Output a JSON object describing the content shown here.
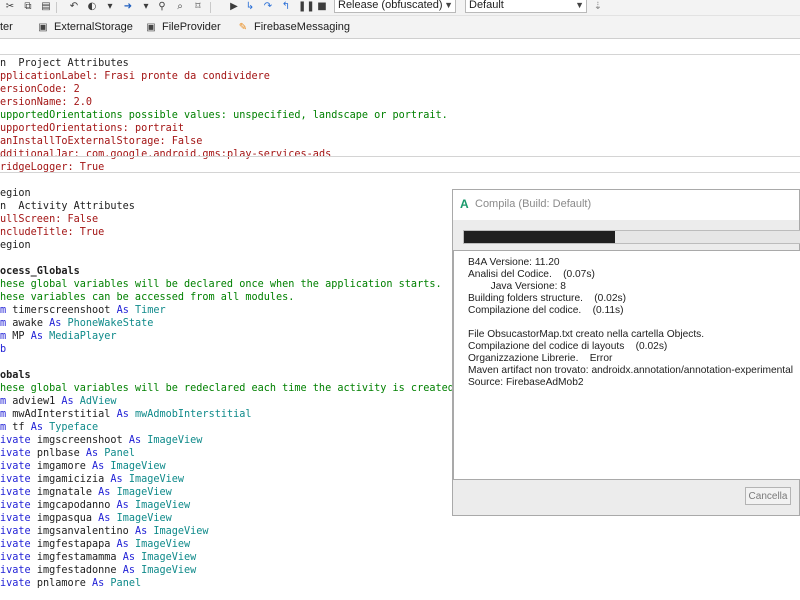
{
  "toolbar": {
    "build_config": "Release (obfuscated)",
    "platform": "Default",
    "icons": [
      "scissors-icon",
      "copy-icon",
      "paste-icon",
      "back-icon",
      "forward-icon",
      "run-icon",
      "step-into-icon",
      "step-over-icon",
      "step-out-icon",
      "pause-icon",
      "stop-icon"
    ]
  },
  "tabs": [
    {
      "label": "ter",
      "icon": ""
    },
    {
      "label": "ExternalStorage",
      "icon": "module-icon"
    },
    {
      "label": "FileProvider",
      "icon": "module-icon"
    },
    {
      "label": "FirebaseMessaging",
      "icon": "firebase-icon"
    }
  ],
  "code": {
    "lines": [
      [
        {
          "t": "n  Project Attributes",
          "c": "plain"
        }
      ],
      [
        {
          "t": "pplicationLabel: ",
          "c": "attr"
        },
        {
          "t": "Frasi pronte da condividere",
          "c": "st"
        }
      ],
      [
        {
          "t": "ersionCode: ",
          "c": "attr"
        },
        {
          "t": "2",
          "c": "st"
        }
      ],
      [
        {
          "t": "ersionName: ",
          "c": "attr"
        },
        {
          "t": "2.0",
          "c": "st"
        }
      ],
      [
        {
          "t": "upportedOrientations possible values: unspecified, landscape or portrait.",
          "c": "cm"
        }
      ],
      [
        {
          "t": "upportedOrientations: ",
          "c": "attr"
        },
        {
          "t": "portrait",
          "c": "st"
        }
      ],
      [
        {
          "t": "anInstallToExternalStorage: ",
          "c": "attr"
        },
        {
          "t": "False",
          "c": "st"
        }
      ],
      [
        {
          "t": "dditionalJar: ",
          "c": "attr"
        },
        {
          "t": "com.google.android.gms:play-services-ads",
          "c": "st"
        }
      ],
      [
        {
          "t": "ridgeLogger: ",
          "c": "attr"
        },
        {
          "t": "True",
          "c": "st"
        }
      ],
      [
        {
          "t": "",
          "c": "plain"
        }
      ],
      [
        {
          "t": "egion",
          "c": "plain"
        }
      ],
      [
        {
          "t": "n  Activity Attributes",
          "c": "plain"
        }
      ],
      [
        {
          "t": "ullScreen: ",
          "c": "attr"
        },
        {
          "t": "False",
          "c": "st"
        }
      ],
      [
        {
          "t": "ncludeTitle: ",
          "c": "attr"
        },
        {
          "t": "True",
          "c": "st"
        }
      ],
      [
        {
          "t": "egion",
          "c": "plain"
        }
      ],
      [
        {
          "t": "",
          "c": "plain"
        }
      ],
      [
        {
          "t": "ocess_Globals",
          "c": "plain",
          "b": true
        }
      ],
      [
        {
          "t": "hese global variables will be declared once when the application starts.",
          "c": "cm"
        }
      ],
      [
        {
          "t": "hese variables can be accessed from all modules.",
          "c": "cm"
        }
      ],
      [
        {
          "t": "m ",
          "c": "kw"
        },
        {
          "t": "timerscreenshoot ",
          "c": "plain"
        },
        {
          "t": "As ",
          "c": "kw"
        },
        {
          "t": "Timer",
          "c": "ty"
        }
      ],
      [
        {
          "t": "m ",
          "c": "kw"
        },
        {
          "t": "awake ",
          "c": "plain"
        },
        {
          "t": "As ",
          "c": "kw"
        },
        {
          "t": "PhoneWakeState",
          "c": "ty"
        }
      ],
      [
        {
          "t": "m ",
          "c": "kw"
        },
        {
          "t": "MP ",
          "c": "plain"
        },
        {
          "t": "As ",
          "c": "kw"
        },
        {
          "t": "MediaPlayer",
          "c": "ty"
        }
      ],
      [
        {
          "t": "b",
          "c": "kw"
        }
      ],
      [
        {
          "t": "",
          "c": "plain"
        }
      ],
      [
        {
          "t": "obals",
          "c": "plain",
          "b": true
        }
      ],
      [
        {
          "t": "hese global variables will be redeclared each time the activity is created.",
          "c": "cm"
        }
      ],
      [
        {
          "t": "m ",
          "c": "kw"
        },
        {
          "t": "adview1 ",
          "c": "plain"
        },
        {
          "t": "As ",
          "c": "kw"
        },
        {
          "t": "AdView",
          "c": "ty"
        }
      ],
      [
        {
          "t": "m ",
          "c": "kw"
        },
        {
          "t": "mwAdInterstitial ",
          "c": "plain"
        },
        {
          "t": "As ",
          "c": "kw"
        },
        {
          "t": "mwAdmobInterstitial",
          "c": "ty"
        }
      ],
      [
        {
          "t": "m ",
          "c": "kw"
        },
        {
          "t": "tf ",
          "c": "plain"
        },
        {
          "t": "As ",
          "c": "kw"
        },
        {
          "t": "Typeface",
          "c": "ty"
        }
      ],
      [
        {
          "t": "ivate ",
          "c": "kw"
        },
        {
          "t": "imgscreenshoot ",
          "c": "plain"
        },
        {
          "t": "As ",
          "c": "kw"
        },
        {
          "t": "ImageView",
          "c": "ty"
        }
      ],
      [
        {
          "t": "ivate ",
          "c": "kw"
        },
        {
          "t": "pnlbase ",
          "c": "plain"
        },
        {
          "t": "As ",
          "c": "kw"
        },
        {
          "t": "Panel",
          "c": "ty"
        }
      ],
      [
        {
          "t": "ivate ",
          "c": "kw"
        },
        {
          "t": "imgamore ",
          "c": "plain"
        },
        {
          "t": "As ",
          "c": "kw"
        },
        {
          "t": "ImageView",
          "c": "ty"
        }
      ],
      [
        {
          "t": "ivate ",
          "c": "kw"
        },
        {
          "t": "imgamicizia ",
          "c": "plain"
        },
        {
          "t": "As ",
          "c": "kw"
        },
        {
          "t": "ImageView",
          "c": "ty"
        }
      ],
      [
        {
          "t": "ivate ",
          "c": "kw"
        },
        {
          "t": "imgnatale ",
          "c": "plain"
        },
        {
          "t": "As ",
          "c": "kw"
        },
        {
          "t": "ImageView",
          "c": "ty"
        }
      ],
      [
        {
          "t": "ivate ",
          "c": "kw"
        },
        {
          "t": "imgcapodanno ",
          "c": "plain"
        },
        {
          "t": "As ",
          "c": "kw"
        },
        {
          "t": "ImageView",
          "c": "ty"
        }
      ],
      [
        {
          "t": "ivate ",
          "c": "kw"
        },
        {
          "t": "imgpasqua ",
          "c": "plain"
        },
        {
          "t": "As ",
          "c": "kw"
        },
        {
          "t": "ImageView",
          "c": "ty"
        }
      ],
      [
        {
          "t": "ivate ",
          "c": "kw"
        },
        {
          "t": "imgsanvalentino ",
          "c": "plain"
        },
        {
          "t": "As ",
          "c": "kw"
        },
        {
          "t": "ImageView",
          "c": "ty"
        }
      ],
      [
        {
          "t": "ivate ",
          "c": "kw"
        },
        {
          "t": "imgfestapapa ",
          "c": "plain"
        },
        {
          "t": "As ",
          "c": "kw"
        },
        {
          "t": "ImageView",
          "c": "ty"
        }
      ],
      [
        {
          "t": "ivate ",
          "c": "kw"
        },
        {
          "t": "imgfestamamma ",
          "c": "plain"
        },
        {
          "t": "As ",
          "c": "kw"
        },
        {
          "t": "ImageView",
          "c": "ty"
        }
      ],
      [
        {
          "t": "ivate ",
          "c": "kw"
        },
        {
          "t": "imgfestadonne ",
          "c": "plain"
        },
        {
          "t": "As ",
          "c": "kw"
        },
        {
          "t": "ImageView",
          "c": "ty"
        }
      ],
      [
        {
          "t": "ivate ",
          "c": "kw"
        },
        {
          "t": "pnlamore ",
          "c": "plain"
        },
        {
          "t": "As ",
          "c": "kw"
        },
        {
          "t": "Panel",
          "c": "ty"
        }
      ]
    ]
  },
  "dialog": {
    "logo": "A",
    "title": "Compila (Build: Default)",
    "progress": 0.45,
    "log": [
      "B4A Versione: 11.20",
      "Analisi del Codice.    (0.07s)",
      "        Java Versione: 8",
      "Building folders structure.    (0.02s)",
      "Compilazione del codice.    (0.11s)",
      "",
      "File ObsucastorMap.txt creato nella cartella Objects.",
      "Compilazione del codice di layouts    (0.02s)",
      "Organizzazione Librerie.    Error",
      "Maven artifact non trovato: androidx.annotation/annotation-experimental",
      "Source: FirebaseAdMob2"
    ],
    "cancel_label": "Cancella"
  }
}
